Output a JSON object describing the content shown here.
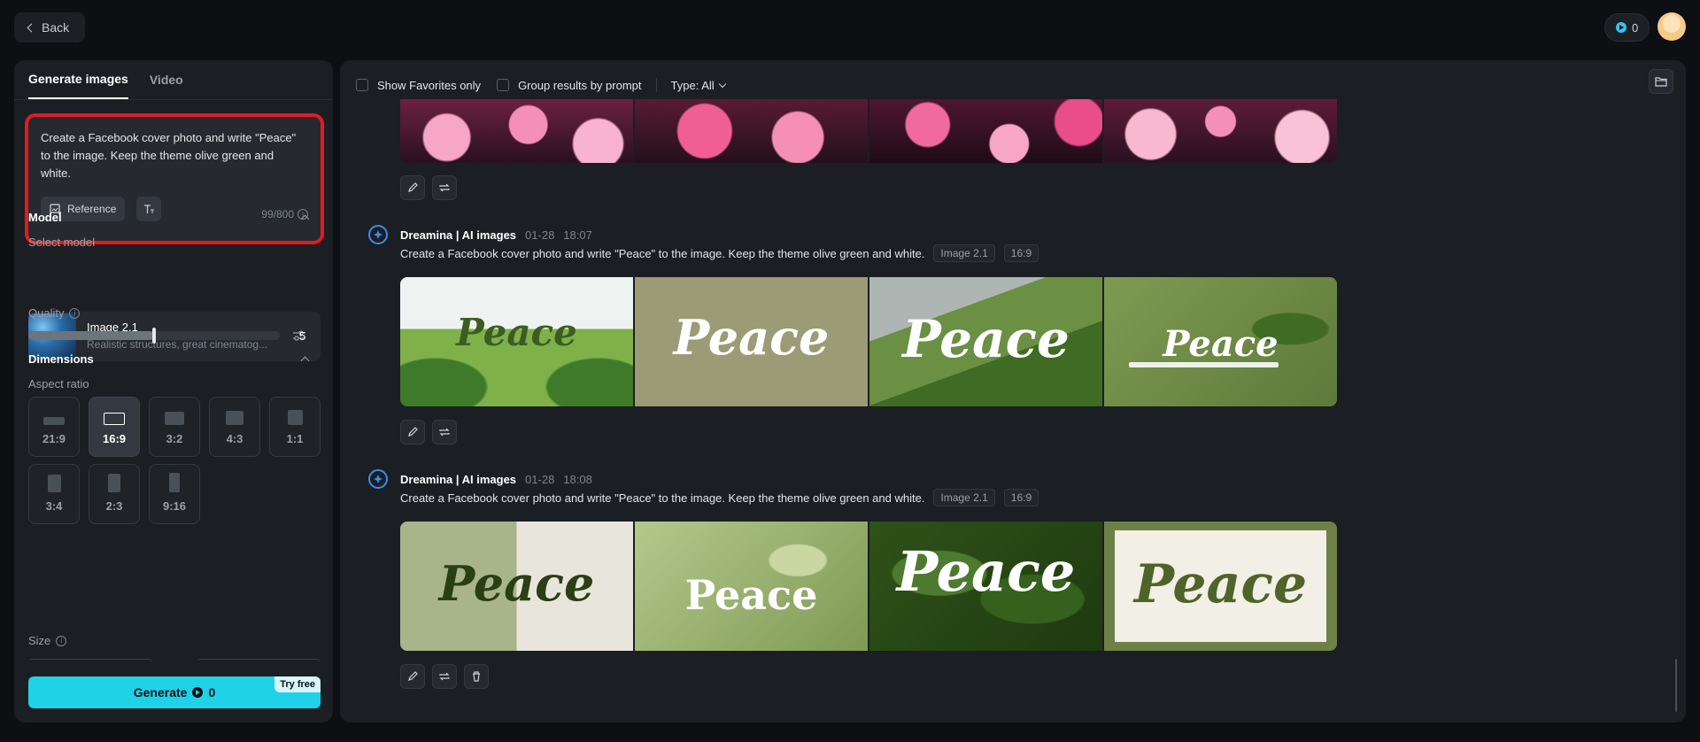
{
  "topbar": {
    "back_label": "Back",
    "credits": "0"
  },
  "left": {
    "tabs": [
      {
        "label": "Generate images",
        "active": true
      },
      {
        "label": "Video",
        "active": false
      }
    ],
    "prompt": {
      "text": "Create a Facebook cover photo and write \"Peace\" to the image. Keep the theme olive green and white.",
      "reference_label": "Reference",
      "char_count": "99/800"
    },
    "model": {
      "section_title": "Model",
      "select_label": "Select model",
      "name": "Image 2.1",
      "description": "Realistic structures, great cinematog..."
    },
    "quality": {
      "label": "Quality",
      "value": "5",
      "level": 0.5
    },
    "dimensions": {
      "section_title": "Dimensions",
      "aspect_label": "Aspect ratio",
      "ratios": [
        "21:9",
        "16:9",
        "3:2",
        "4:3",
        "1:1",
        "3:4",
        "2:3",
        "9:16"
      ],
      "selected": "16:9"
    },
    "size_label": "Size",
    "generate": {
      "label": "Generate",
      "credits": "0",
      "badge": "Try free"
    }
  },
  "main": {
    "filters": {
      "favorites_label": "Show Favorites only",
      "group_label": "Group results by prompt",
      "type_label": "Type: All"
    },
    "generations": [
      {
        "name": "Dreamina | AI images",
        "date": "01-28",
        "time": "18:07",
        "prompt": "Create a Facebook cover photo and write \"Peace\" to the image. Keep the theme olive green and white.",
        "model_tag": "Image 2.1",
        "ratio_tag": "16:9",
        "images": [
          "Peace",
          "Peace",
          "Peace",
          "Peace"
        ]
      },
      {
        "name": "Dreamina | AI images",
        "date": "01-28",
        "time": "18:08",
        "prompt": "Create a Facebook cover photo and write \"Peace\" to the image. Keep the theme olive green and white.",
        "model_tag": "Image 2.1",
        "ratio_tag": "16:9",
        "images": [
          "Peace",
          "Peace",
          "Peace",
          "Peace"
        ]
      }
    ]
  },
  "colors": {
    "accent": "#1fd2e8",
    "highlight_border": "#e01b24",
    "panel": "#1b1e23",
    "background": "#0d0f12"
  }
}
